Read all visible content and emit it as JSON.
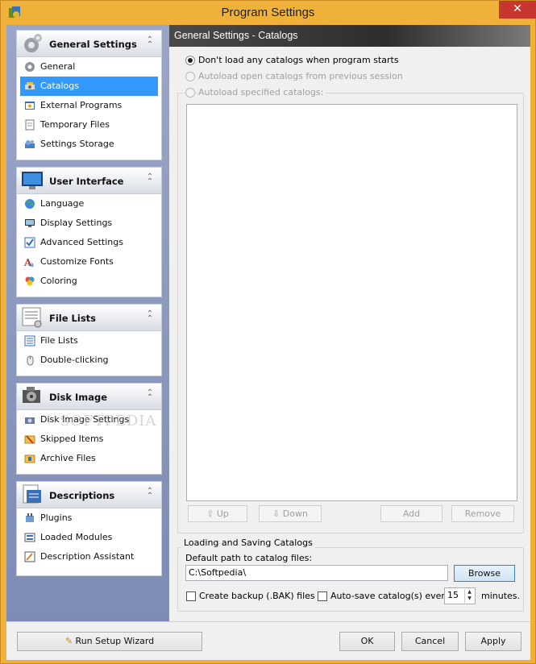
{
  "window": {
    "title": "Program Settings",
    "close_label": "✕"
  },
  "sidebar": {
    "groups": [
      {
        "title": "General Settings",
        "icon": "gears-icon",
        "items": [
          {
            "label": "General",
            "icon": "gear-icon"
          },
          {
            "label": "Catalogs",
            "icon": "catalog-icon",
            "selected": true
          },
          {
            "label": "External Programs",
            "icon": "external-programs-icon"
          },
          {
            "label": "Temporary Files",
            "icon": "temporary-files-icon"
          },
          {
            "label": "Settings Storage",
            "icon": "settings-storage-icon"
          }
        ]
      },
      {
        "title": "User Interface",
        "icon": "monitor-icon",
        "items": [
          {
            "label": "Language",
            "icon": "globe-icon"
          },
          {
            "label": "Display Settings",
            "icon": "display-icon"
          },
          {
            "label": "Advanced Settings",
            "icon": "checklist-icon"
          },
          {
            "label": "Customize Fonts",
            "icon": "font-icon"
          },
          {
            "label": "Coloring",
            "icon": "palette-icon"
          }
        ]
      },
      {
        "title": "File Lists",
        "icon": "file-list-icon",
        "items": [
          {
            "label": "File Lists",
            "icon": "list-icon"
          },
          {
            "label": "Double-clicking",
            "icon": "mouse-icon"
          }
        ]
      },
      {
        "title": "Disk Image",
        "icon": "disk-image-icon",
        "items": [
          {
            "label": "Disk Image Settings",
            "icon": "disk-settings-icon"
          },
          {
            "label": "Skipped Items",
            "icon": "skipped-items-icon"
          },
          {
            "label": "Archive Files",
            "icon": "archive-icon"
          }
        ]
      },
      {
        "title": "Descriptions",
        "icon": "descriptions-icon",
        "items": [
          {
            "label": "Plugins",
            "icon": "plugin-icon"
          },
          {
            "label": "Loaded Modules",
            "icon": "modules-icon"
          },
          {
            "label": "Description Assistant",
            "icon": "assistant-icon"
          }
        ]
      }
    ]
  },
  "main": {
    "header": "General Settings - Catalogs",
    "options": {
      "dont_load": "Don't load any catalogs when program starts",
      "autoload_open": "Autoload open catalogs from previous session",
      "autoload_specified": "Autoload specified catalogs:"
    },
    "list_buttons": {
      "up": "Up",
      "down": "Down",
      "add": "Add",
      "remove": "Remove"
    },
    "loading_saving": {
      "group_title": "Loading and Saving Catalogs",
      "default_path_label": "Default path to catalog files:",
      "default_path_value": "C:\\Softpedia\\",
      "browse": "Browse",
      "create_backup": "Create backup (.BAK) files",
      "auto_save": "Auto-save catalog(s) every",
      "auto_save_value": "15",
      "minutes": "minutes."
    }
  },
  "watermark": "SOFTPEDIA",
  "footer": {
    "wizard": "Run Setup Wizard",
    "ok": "OK",
    "cancel": "Cancel",
    "apply": "Apply"
  }
}
